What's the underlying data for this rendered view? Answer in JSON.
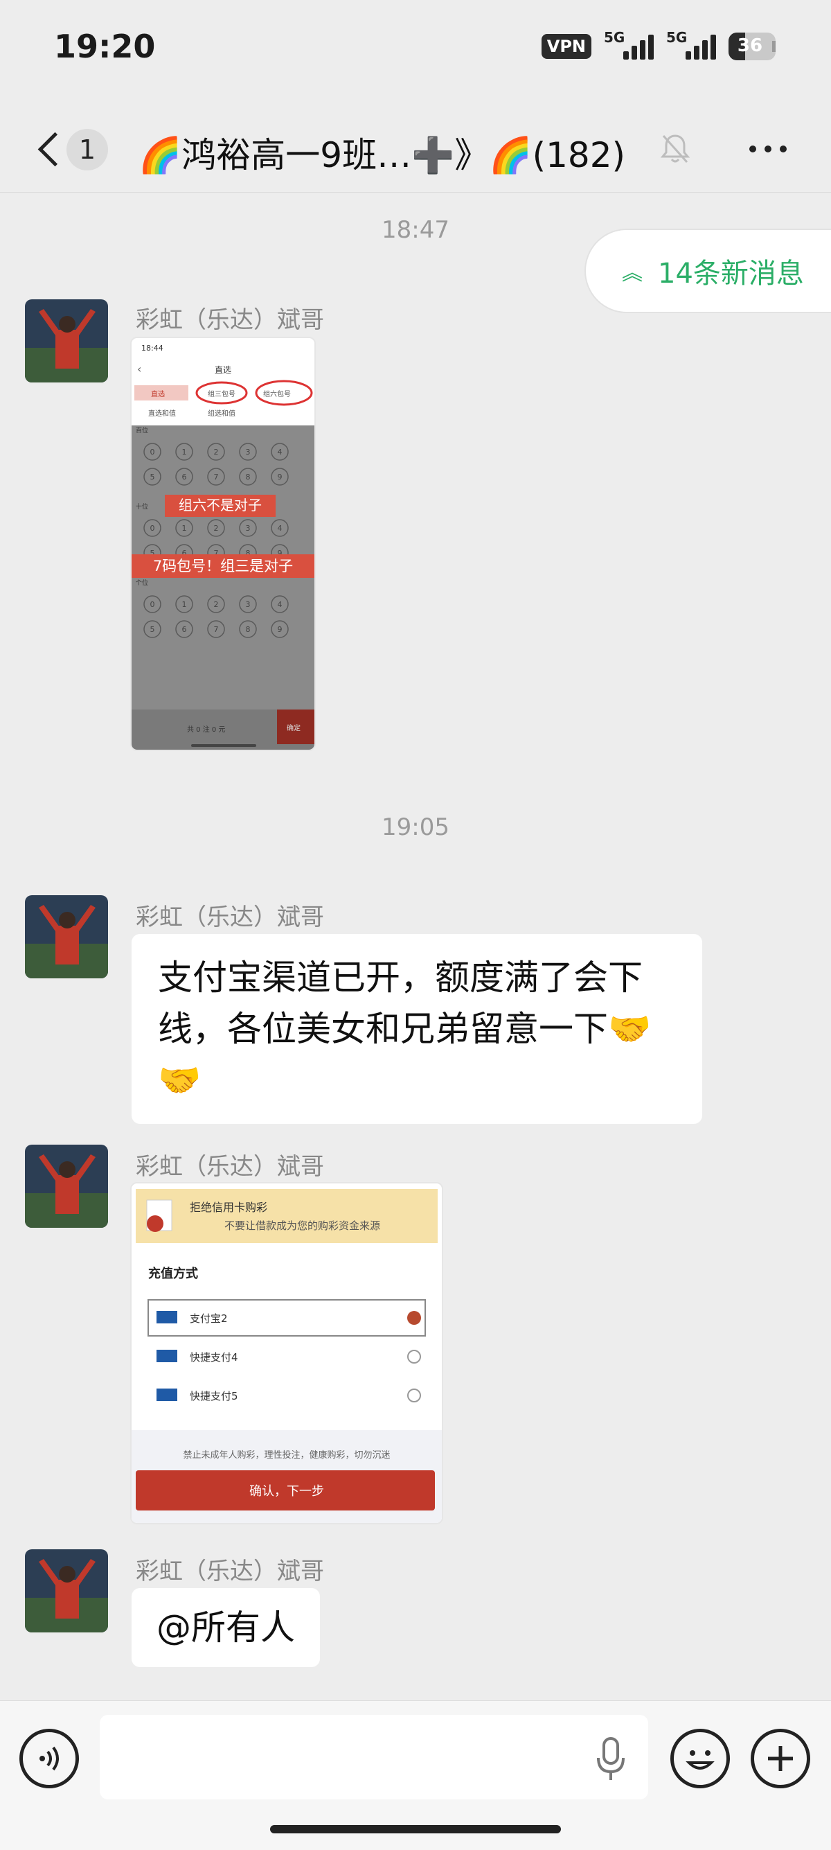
{
  "status_bar": {
    "time": "19:20",
    "vpn": "VPN",
    "net1": "5G",
    "net2": "5G",
    "battery": "36",
    "battery_level": 0.36
  },
  "header": {
    "unread_count": "1",
    "title": "🌈鸿裕高一9班…➕》🌈(182)"
  },
  "new_messages_pill": "14条新消息",
  "messages": [
    {
      "timestamp": "18:47",
      "sender": "彩虹（乐达）斌哥",
      "image": {
        "time": "18:44",
        "nav_title": "直选",
        "tabs": [
          "直选",
          "组三包号",
          "组六包号",
          "直选和值",
          "组选和值"
        ],
        "row_labels": [
          "百位",
          "十位",
          "个位"
        ],
        "digits": [
          "0",
          "1",
          "2",
          "3",
          "4",
          "5",
          "6",
          "7",
          "8",
          "9"
        ],
        "overlay1": "组六不是对子",
        "overlay2": "7码包号！组三是对子",
        "footer_left": "共 0 注 0 元",
        "footer_right": "确定"
      }
    },
    {
      "timestamp": "19:05",
      "sender": "彩虹（乐达）斌哥",
      "text": "支付宝渠道已开，额度满了会下线，各位美女和兄弟留意一下🤝🤝"
    },
    {
      "sender": "彩虹（乐达）斌哥",
      "image": {
        "banner_line1": "拒绝信用卡购彩",
        "banner_line2": "不要让借款成为您的购彩资金来源",
        "section_title": "充值方式",
        "options": [
          "支付宝2",
          "快捷支付4",
          "快捷支付5"
        ],
        "notice": "禁止未成年人购彩，理性投注，健康购彩，切勿沉迷",
        "confirm": "确认，下一步"
      }
    },
    {
      "sender": "彩虹（乐达）斌哥",
      "text": "@所有人"
    }
  ],
  "colors": {
    "accent_green": "#2bae67",
    "bubble": "#ffffff",
    "background": "#ededed",
    "red_button": "#c0392b"
  },
  "icons": [
    "back-icon",
    "bell-off-icon",
    "more-icon",
    "voice-icon",
    "mic-icon",
    "emoji-icon",
    "plus-icon"
  ]
}
